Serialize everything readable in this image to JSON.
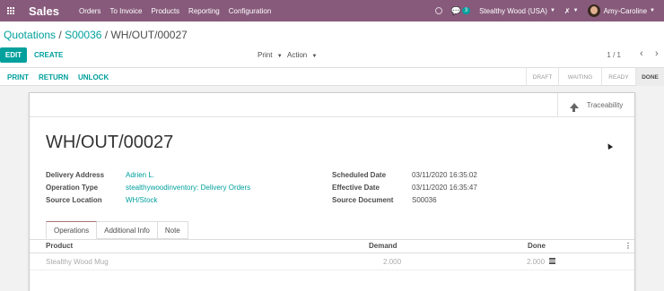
{
  "navbar": {
    "app_name": "Sales",
    "menu": [
      "Orders",
      "To Invoice",
      "Products",
      "Reporting",
      "Configuration"
    ],
    "chat_badge": "3",
    "company": "Stealthy Wood (USA)",
    "user": "Amy-Caroline",
    "icons": [
      "apps-grid-icon",
      "clock-icon",
      "chat-icon",
      "debug-icon",
      "avatar"
    ]
  },
  "breadcrumb": {
    "first": "Quotations",
    "sep": " / ",
    "second": "S00036",
    "third": "WH/OUT/00027"
  },
  "control": {
    "edit_label": "EDIT",
    "create_label": "CREATE",
    "print_label": "Print",
    "action_label": "Action",
    "pager": "1 / 1"
  },
  "statusbar": {
    "buttons": [
      "PRINT",
      "RETURN",
      "UNLOCK"
    ],
    "stages": [
      "DRAFT",
      "WAITING",
      "READY",
      "DONE"
    ],
    "active_stage": "DONE"
  },
  "sheet": {
    "traceability_label": "Traceability",
    "title": "WH/OUT/00027",
    "left_fields": [
      {
        "label": "Delivery Address",
        "value": "Adrien L."
      },
      {
        "label": "Operation Type",
        "value": "stealthywoodinventory: Delivery Orders"
      },
      {
        "label": "Source Location",
        "value": "WH/Stock"
      }
    ],
    "right_fields": [
      {
        "label": "Scheduled Date",
        "value": "03/11/2020 16:35:02"
      },
      {
        "label": "Effective Date",
        "value": "03/11/2020 16:35:47"
      },
      {
        "label": "Source Document",
        "value": "S00036"
      }
    ],
    "tabs": [
      "Operations",
      "Additional Info",
      "Note"
    ],
    "table": {
      "headers": [
        "Product",
        "Demand",
        "Done"
      ],
      "rows": [
        {
          "product": "Stealthy Wood Mug",
          "demand": "2.000",
          "done": "2.000"
        }
      ]
    }
  },
  "colors": {
    "primary": "#875a7b",
    "accent": "#00a09d"
  }
}
